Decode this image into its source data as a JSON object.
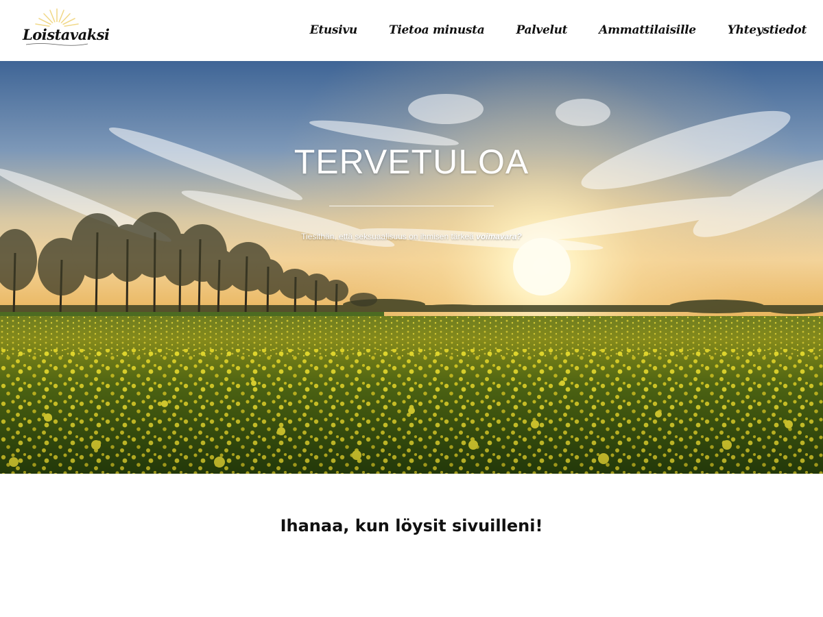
{
  "header": {
    "logo_text": "Loistavaksi",
    "nav": [
      {
        "label": "Etusivu"
      },
      {
        "label": "Tietoa minusta"
      },
      {
        "label": "Palvelut"
      },
      {
        "label": "Ammattilaisille"
      },
      {
        "label": "Yhteystiedot"
      }
    ]
  },
  "hero": {
    "title": "TERVETULOA",
    "subtitle_prefix": "Tiesithän, että seksuaalisuus on ihmisen tärkeä ",
    "subtitle_emphasis": "voimavara?"
  },
  "main": {
    "welcome_heading": "Ihanaa, kun löysit sivuilleni!"
  },
  "colors": {
    "header_bg": "#ffffff",
    "text": "#111111",
    "hero_text": "#ffffff",
    "sky_top": "#4a6f9e",
    "sun": "#fff3c4",
    "field_green": "#4f6a12",
    "flower_yellow": "#e7dc2a"
  }
}
